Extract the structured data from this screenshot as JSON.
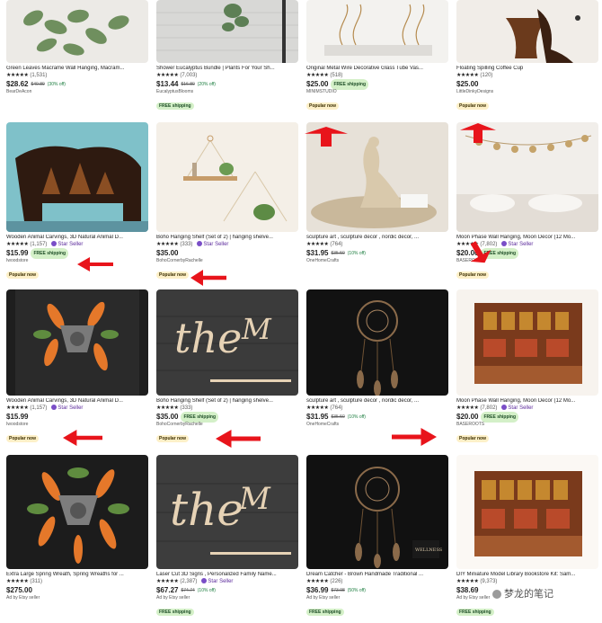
{
  "rows": [
    {
      "items": [
        {
          "title": "Green Leaves Macrame Wall Hanging, Macram...",
          "stars": "★★★★★",
          "count": "(1,531)",
          "price": "$28.62",
          "orig": "$40.89",
          "off": "(30% off)",
          "seller": "BearDeAcon",
          "star_seller": "",
          "ship_inline": "",
          "badge": "",
          "badge_type": ""
        },
        {
          "title": "Shower Eucalyptus Bundle | Plants For Your Sh...",
          "stars": "★★★★★",
          "count": "(7,003)",
          "price": "$13.44",
          "orig": "$16.80",
          "off": "(20% off)",
          "seller": "EucalyptusBlooms",
          "star_seller": "",
          "ship_inline": "",
          "badge": "FREE shipping",
          "badge_type": "ship"
        },
        {
          "title": "Original Metal Wire Decorative Glass Tube Vas...",
          "stars": "★★★★★",
          "count": "(518)",
          "price": "$25.00",
          "orig": "",
          "off": "",
          "seller": "MINIMSTUDIO",
          "star_seller": "",
          "ship_inline": "FREE shipping",
          "badge": "Popular now",
          "badge_type": "pop"
        },
        {
          "title": "Floating Spilling Coffee Cup",
          "stars": "★★★★★",
          "count": "(120)",
          "price": "$25.00",
          "orig": "",
          "off": "",
          "seller": "LittleDinkyDesigns",
          "star_seller": "",
          "ship_inline": "",
          "badge": "Popular now",
          "badge_type": "pop"
        }
      ]
    },
    {
      "items": [
        {
          "title": "Wooden Animal Carvings, 3D Natural Animal D...",
          "stars": "★★★★★",
          "count": "(1,157)",
          "price": "$15.99",
          "orig": "",
          "off": "",
          "seller": "Iwoodstore",
          "star_seller": "Star Seller",
          "ship_inline": "FREE shipping",
          "badge": "Popular now",
          "badge_type": "pop"
        },
        {
          "title": "Boho Hanging Shelf (Set of 2) | hanging shelve...",
          "stars": "★★★★★",
          "count": "(333)",
          "price": "$35.00",
          "orig": "",
          "off": "",
          "seller": "BohoCornerbyRachelle",
          "star_seller": "Star Seller",
          "ship_inline": "",
          "badge": "Popular now",
          "badge_type": "pop"
        },
        {
          "title": "sculpture art , sculpture decor , nordic decor, ...",
          "stars": "★★★★★",
          "count": "(764)",
          "price": "$31.95",
          "orig": "$35.50",
          "off": "(10% off)",
          "seller": "OneHomeCrafts",
          "star_seller": "",
          "ship_inline": "",
          "badge": "",
          "badge_type": ""
        },
        {
          "title": "Moon Phase Wall Hanging, Moon Decor (12 Mo...",
          "stars": "★★★★★",
          "count": "(7,802)",
          "price": "$20.00",
          "orig": "",
          "off": "",
          "seller": "BASEROOTS",
          "star_seller": "Star Seller",
          "ship_inline": "FREE shipping",
          "badge": "Popular now",
          "badge_type": "pop"
        }
      ]
    },
    {
      "items": [
        {
          "title": "Wooden Animal Carvings, 3D Natural Animal D...",
          "stars": "★★★★★",
          "count": "(1,157)",
          "price": "$15.99",
          "orig": "",
          "off": "",
          "seller": "Iwoodstore",
          "star_seller": "Star Seller",
          "ship_inline": "",
          "badge": "Popular now",
          "badge_type": "pop"
        },
        {
          "title": "Boho Hanging Shelf (Set of 2) | hanging shelve...",
          "stars": "★★★★★",
          "count": "(333)",
          "price": "$35.00",
          "orig": "",
          "off": "",
          "seller": "BohoCornerbyRachelle",
          "star_seller": "",
          "ship_inline": "FREE shipping",
          "badge": "Popular now",
          "badge_type": "pop"
        },
        {
          "title": "sculpture art , sculpture decor , nordic decor, ...",
          "stars": "★★★★★",
          "count": "(764)",
          "price": "$31.95",
          "orig": "$35.50",
          "off": "(10% off)",
          "seller": "OneHomeCrafts",
          "star_seller": "",
          "ship_inline": "",
          "badge": "",
          "badge_type": ""
        },
        {
          "title": "Moon Phase Wall Hanging, Moon Decor (12 Mo...",
          "stars": "★★★★★",
          "count": "(7,802)",
          "price": "$20.00",
          "orig": "",
          "off": "",
          "seller": "BASEROOTS",
          "star_seller": "Star Seller",
          "ship_inline": "FREE shipping",
          "badge": "Popular now",
          "badge_type": "pop"
        }
      ]
    },
    {
      "items": [
        {
          "title": "Extra Large Spring Wreath, Spring Wreaths for ...",
          "stars": "★★★★★",
          "count": "(311)",
          "price": "$275.00",
          "orig": "",
          "off": "",
          "seller": "Ad by Etsy seller",
          "star_seller": "",
          "ship_inline": "",
          "badge": "",
          "badge_type": ""
        },
        {
          "title": "Laser Cut 3D Signs , Personalized Family Name...",
          "stars": "★★★★★",
          "count": "(2,387)",
          "price": "$67.27",
          "orig": "$74.74",
          "off": "(10% off)",
          "seller": "Ad by Etsy seller",
          "star_seller": "Star Seller",
          "ship_inline": "",
          "badge": "FREE shipping",
          "badge_type": "ship"
        },
        {
          "title": "Dream Catcher - Brown Handmade Traditional ...",
          "stars": "★★★★★",
          "count": "(226)",
          "price": "$36.99",
          "orig": "$73.98",
          "off": "(50% off)",
          "seller": "Ad by Etsy seller",
          "star_seller": "",
          "ship_inline": "",
          "badge": "FREE shipping",
          "badge_type": "ship"
        },
        {
          "title": "DIY Miniature Model Library Bookstore Kit: Sam...",
          "stars": "★★★★★",
          "count": "(9,373)",
          "price": "$38.69",
          "orig": "",
          "off": "",
          "seller": "Ad by Etsy seller",
          "star_seller": "",
          "ship_inline": "",
          "badge": "FREE shipping",
          "badge_type": "ship"
        }
      ]
    }
  ],
  "watermark": "梦龙的笔记",
  "colors": {
    "arrow": "#e8141b",
    "ship_bg": "#d4f0c8",
    "popular_bg": "#fdf0c8"
  }
}
